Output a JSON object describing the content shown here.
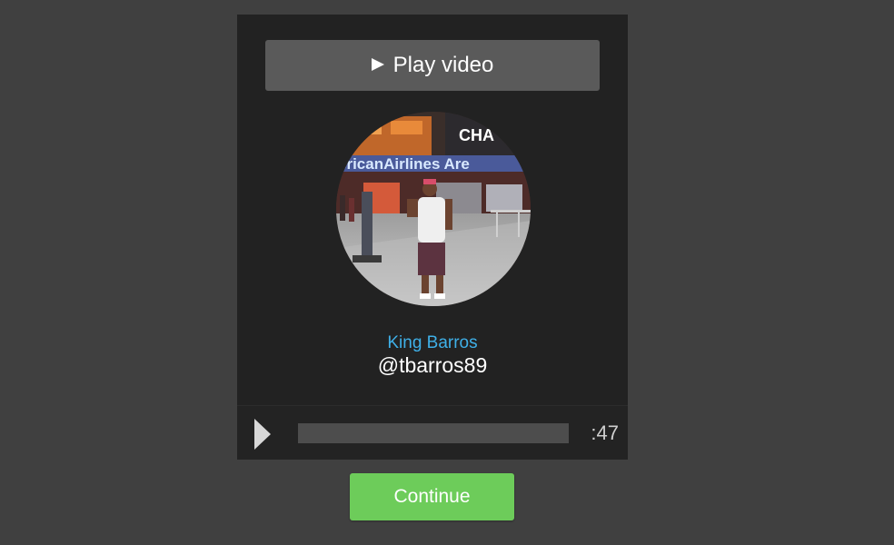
{
  "player": {
    "play_video_label": "Play video",
    "avatar_icon": "profile-photo",
    "display_name": "King Barros",
    "handle": "@tbarros89",
    "time_remaining": ":47",
    "progress": 0
  },
  "actions": {
    "continue_label": "Continue"
  },
  "colors": {
    "page_background": "#404040",
    "player_background": "#222222",
    "name_color": "#3fb0e8",
    "continue_button": "#6dcc5a"
  }
}
